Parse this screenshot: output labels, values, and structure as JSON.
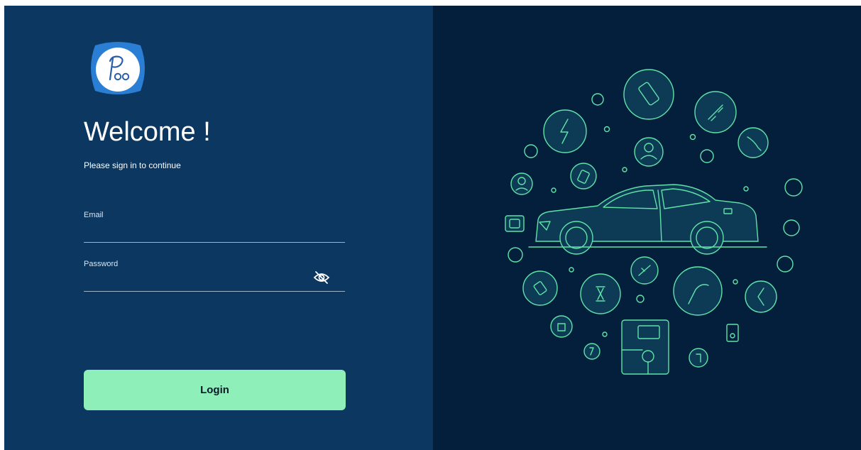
{
  "brand": {
    "logo_text": "Poo"
  },
  "login": {
    "title": "Welcome !",
    "subtitle": "Please sign in to continue",
    "email_label": "Email",
    "email_value": "",
    "password_label": "Password",
    "password_value": "",
    "password_toggle_icon": "eye-slash-icon",
    "login_label": "Login"
  },
  "colors": {
    "left_panel": "#0b3760",
    "right_panel": "#041f3b",
    "accent": "#8ef0b8",
    "illustration_line": "#5fe3a8"
  }
}
